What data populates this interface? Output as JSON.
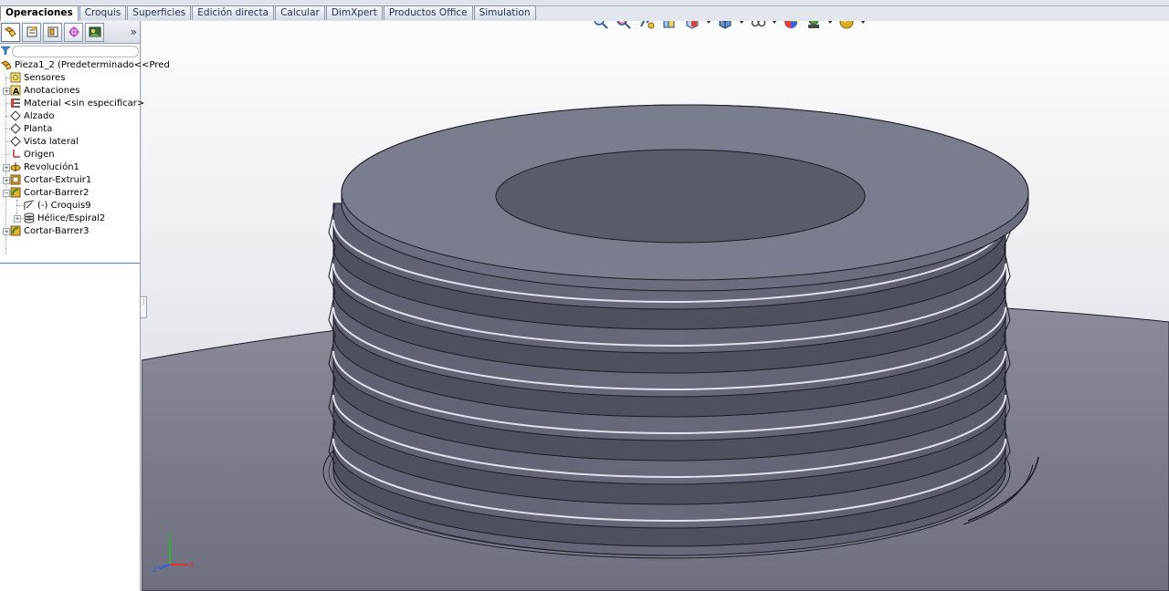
{
  "command_manager": {
    "tabs": [
      {
        "label": "Operaciones",
        "active": true
      },
      {
        "label": "Croquis"
      },
      {
        "label": "Superficies"
      },
      {
        "label": "Edición directa"
      },
      {
        "label": "Calcular"
      },
      {
        "label": "DimXpert"
      },
      {
        "label": "Productos Office"
      },
      {
        "label": "Simulation"
      }
    ]
  },
  "feature_manager": {
    "toolbar_icons": [
      "featuremanager-tree-icon",
      "propertymanager-icon",
      "configurationmanager-icon",
      "dimxpertmanager-icon",
      "display-manager-icon"
    ],
    "expand_label": "»",
    "tree": {
      "root": "Pieza1_2  (Predeterminado<<Pred",
      "items": [
        {
          "label": "Sensores",
          "icon": "sensors-icon"
        },
        {
          "label": "Anotaciones",
          "icon": "annotations-icon"
        },
        {
          "label": "Material <sin especificar>",
          "icon": "material-icon"
        },
        {
          "label": "Alzado",
          "icon": "plane-icon"
        },
        {
          "label": "Planta",
          "icon": "plane-icon"
        },
        {
          "label": "Vista lateral",
          "icon": "plane-icon"
        },
        {
          "label": "Origen",
          "icon": "origin-icon"
        },
        {
          "label": "Revolución1",
          "icon": "revolve-icon"
        },
        {
          "label": "Cortar-Extruir1",
          "icon": "cut-extrude-icon"
        },
        {
          "label": "Cortar-Barrer2",
          "icon": "cut-sweep-icon"
        },
        {
          "label": "(-) Croquis9",
          "icon": "sketch-icon"
        },
        {
          "label": "Hélice/Espiral2",
          "icon": "helix-icon"
        },
        {
          "label": "Cortar-Barrer3",
          "icon": "cut-sweep-icon"
        }
      ]
    }
  },
  "heads_up_toolbar": [
    "zoom-to-fit-icon",
    "zoom-to-area-icon",
    "previous-view-icon",
    "section-view-icon",
    "view-orientation-icon",
    "display-style-icon",
    "hide-show-items-icon",
    "edit-appearance-icon",
    "apply-scene-icon",
    "view-settings-icon"
  ],
  "triad": {
    "x": "X",
    "y": "Y",
    "z": "Z",
    "colors": {
      "x": "#e03030",
      "y": "#30b030",
      "z": "#3060e0"
    }
  },
  "colors": {
    "model": "#7e8090",
    "model_edge": "#1a1c24",
    "viewport_top": "#fbfcfd",
    "selection_line": "#5b7fb5"
  }
}
